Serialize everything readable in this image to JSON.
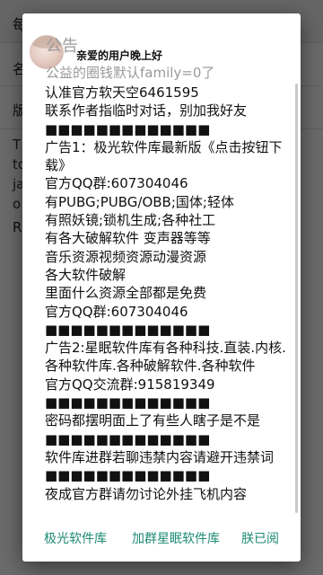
{
  "background": {
    "top_label": "每",
    "row_label_1": "名",
    "row_label_2": "版",
    "side_text": [
      "T",
      "to",
      "ja",
      "o"
    ],
    "row_label_3": "R"
  },
  "dialog": {
    "title": "公告",
    "greeting": "亲爱的用户晚上好",
    "subtitle": "公益的圈钱默认family=0了",
    "message_lines": [
      "认准官方软天空6461595",
      "联系作者指临时对话，别加我好友",
      "■■■■■■■■■■■■■",
      "广告1：极光软件库最新版《点击按钮下载》",
      "官方QQ群:607304046",
      "有PUBG;PUBG/OBB;国体;轻体",
      "有照妖镜;锁机生成;各种社工",
      "有各大破解软件 变声器等等",
      "音乐资源视频资源动漫资源",
      "各大软件破解",
      "里面什么资源全部都是免费",
      "官方QQ群:607304046",
      "■■■■■■■■■■■■■",
      "广告2:星眠软件库有各种科技.直装.内核.",
      "各种软件库.各种破解软件.各种软件",
      "官方QQ交流群:915819349",
      "■■■■■■■■■■■■■",
      "密码都摆明面上了有些人瞎子是不是",
      "■■■■■■■■■■■■■",
      "软件库进群若聊违禁内容请避开违禁词",
      "■■■■■■■■■■■■■",
      "夜成官方群请勿讨论外挂飞机内容"
    ],
    "buttons": {
      "button_1": "极光软件库",
      "button_2": "加群星眠软件库",
      "button_3": "朕已阅"
    }
  },
  "colors": {
    "accent": "#1d8a74",
    "overlay": "#000000"
  }
}
